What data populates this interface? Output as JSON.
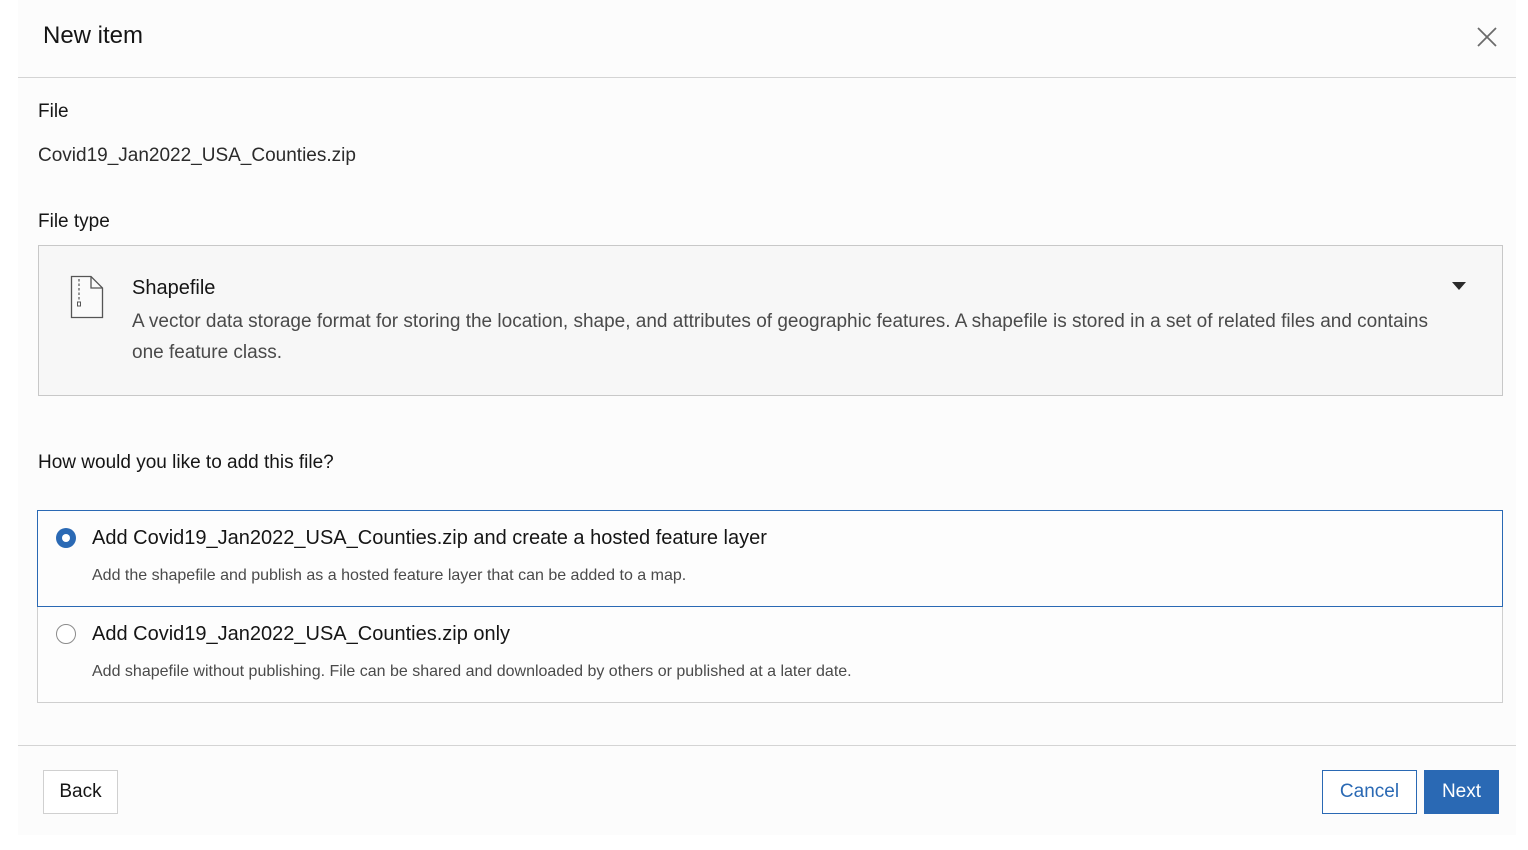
{
  "dialog": {
    "title": "New item",
    "close_icon": "close-icon"
  },
  "file": {
    "label": "File",
    "name": "Covid19_Jan2022_USA_Counties.zip"
  },
  "file_type": {
    "label": "File type",
    "icon": "file-zip-icon",
    "selected_name": "Shapefile",
    "selected_description": "A vector data storage format for storing the location, shape, and attributes of geographic features. A shapefile is stored in a set of related files and contains one feature class.",
    "dropdown_icon": "caret-down-icon"
  },
  "add_method": {
    "question": "How would you like to add this file?",
    "options": [
      {
        "title": "Add Covid19_Jan2022_USA_Counties.zip and create a hosted feature layer",
        "description": "Add the shapefile and publish as a hosted feature layer that can be added to a map.",
        "selected": true
      },
      {
        "title": "Add Covid19_Jan2022_USA_Counties.zip only",
        "description": "Add shapefile without publishing. File can be shared and downloaded by others or published at a later date.",
        "selected": false
      }
    ]
  },
  "footer": {
    "back_label": "Back",
    "cancel_label": "Cancel",
    "next_label": "Next"
  },
  "colors": {
    "accent": "#2a69b4",
    "border": "#cfcfcf",
    "text": "#151515",
    "muted_text": "#4a4a4a"
  }
}
